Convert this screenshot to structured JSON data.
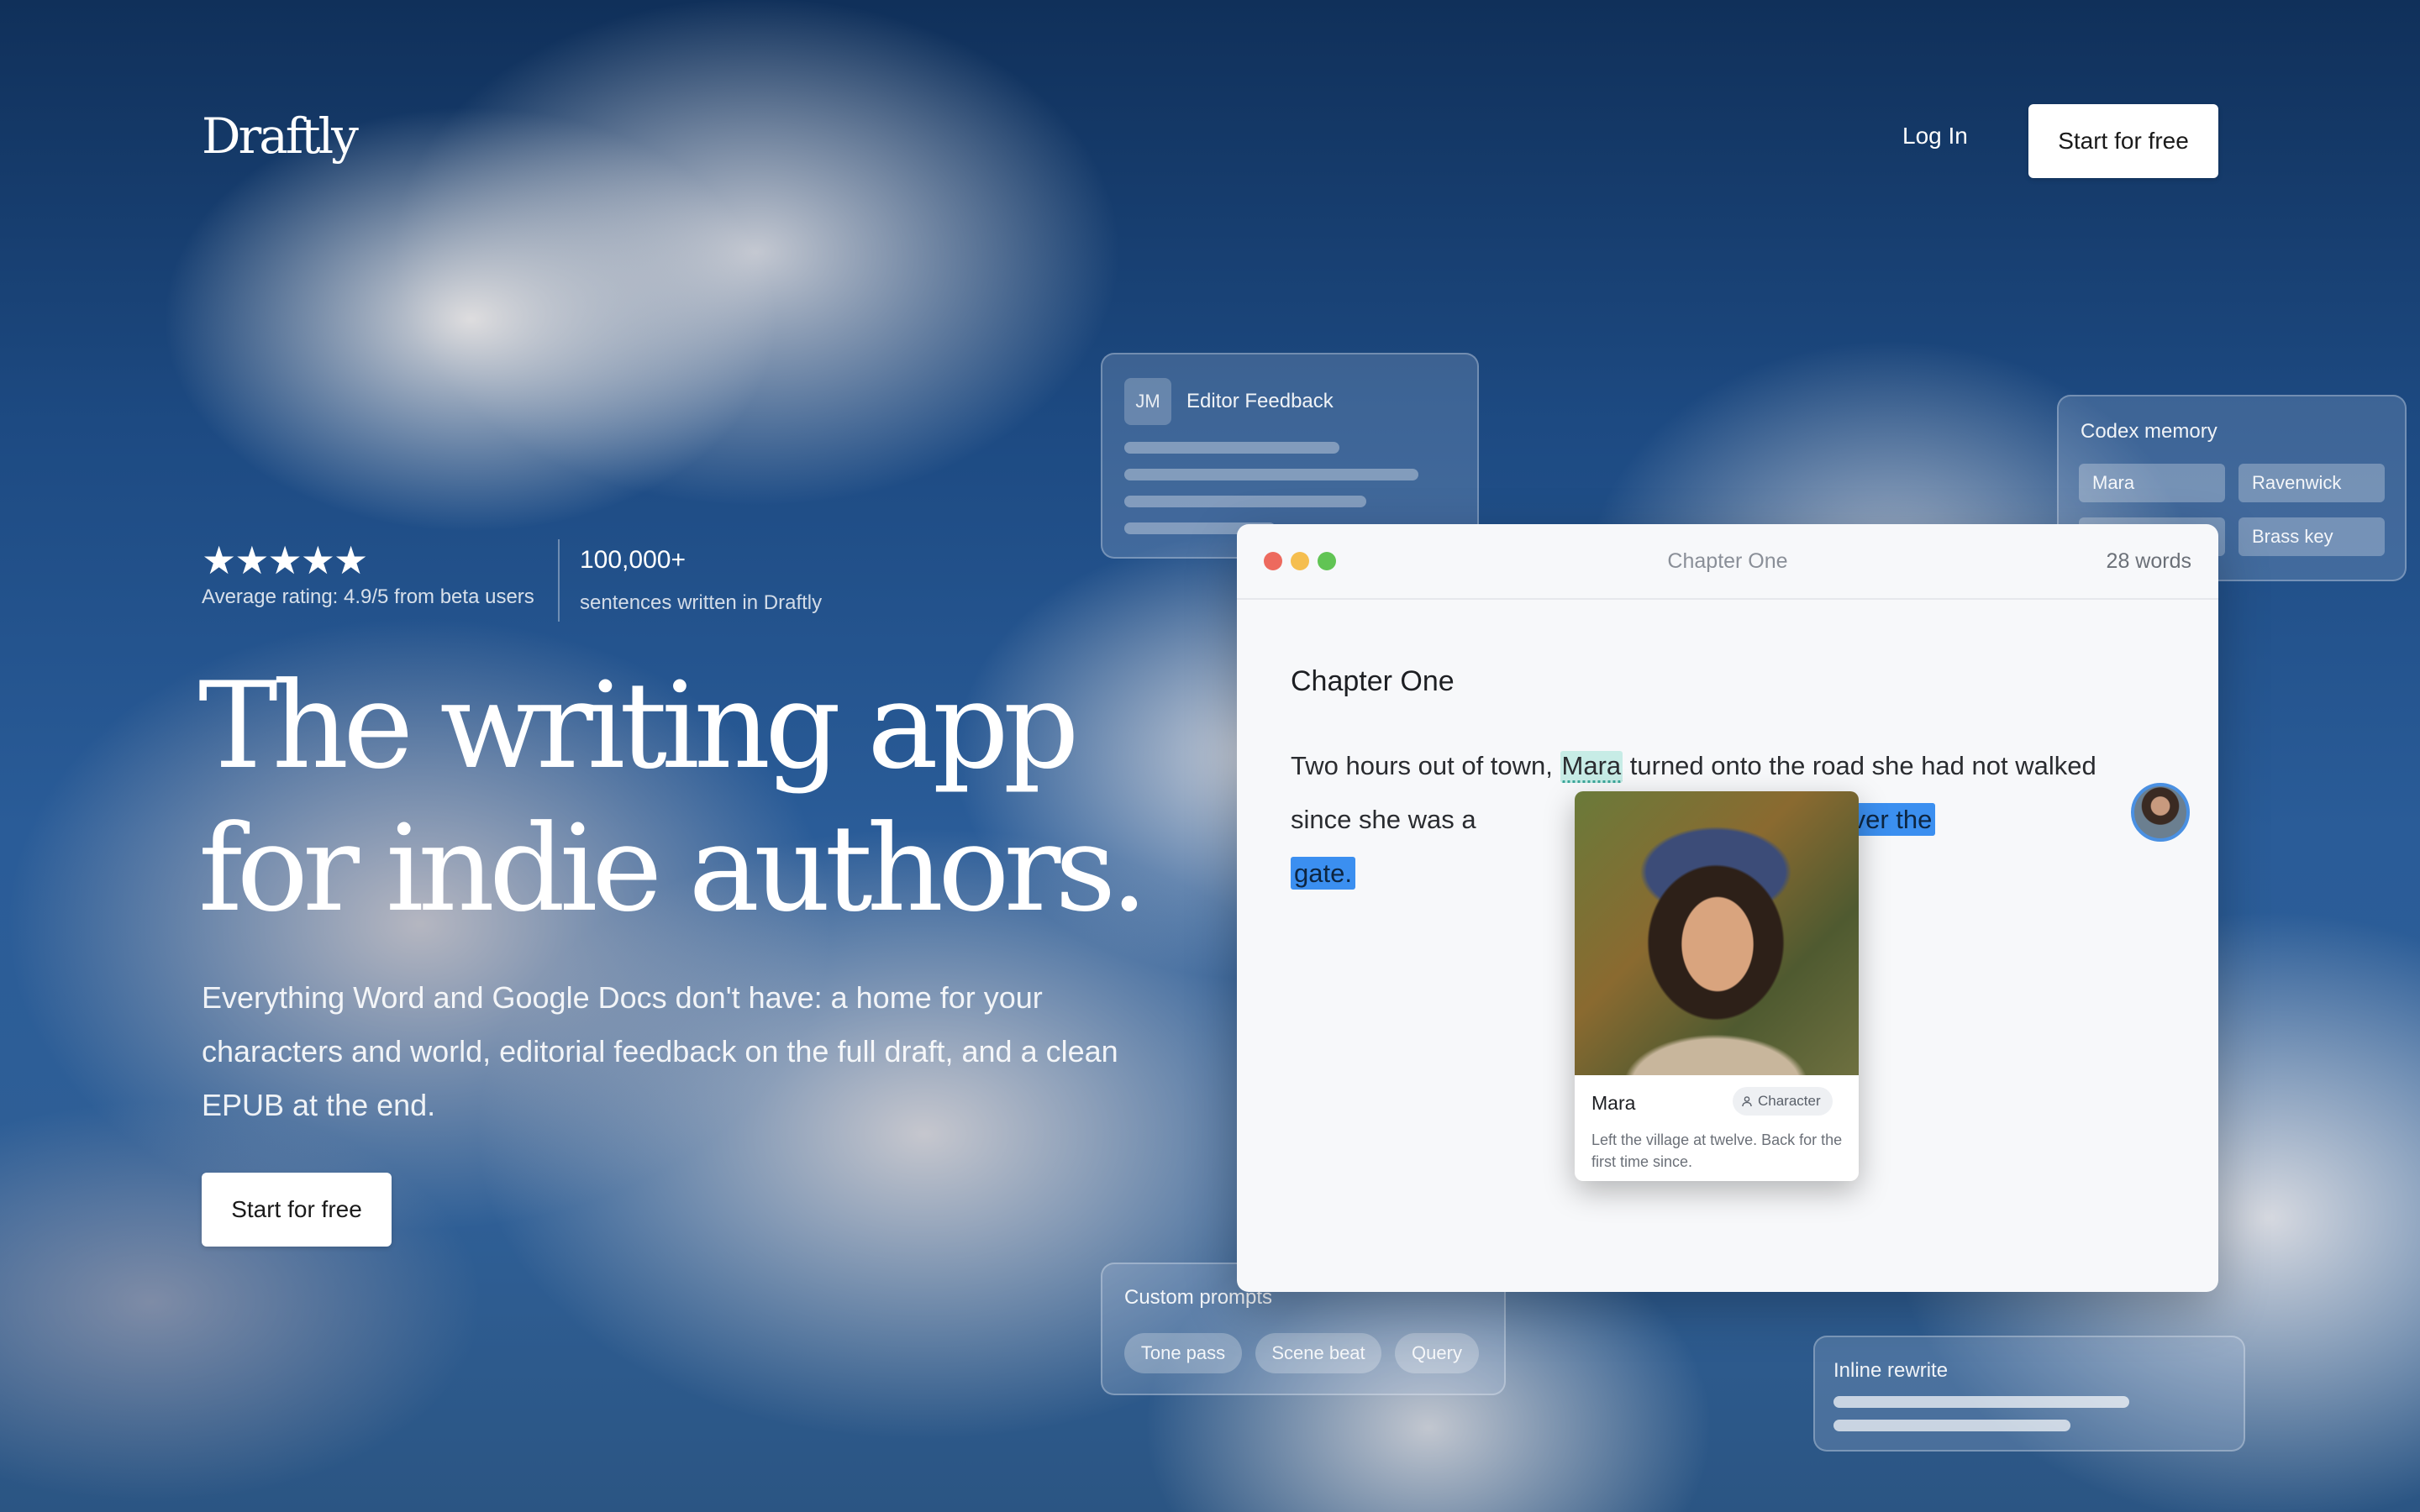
{
  "brand": {
    "logo": "Draftly"
  },
  "nav": {
    "login": "Log In",
    "cta": "Start for free"
  },
  "rating": {
    "stars": "★★★★★",
    "text": "Average rating: 4.9/5 from beta users",
    "stat_value": "100,000+",
    "stat_label": "sentences written in Draftly"
  },
  "hero": {
    "title_line1": "The writing app",
    "title_line2": "for indie authors.",
    "subtitle": "Everything Word and Google Docs don't have: a home for your characters and world, editorial feedback on the full draft, and a clean EPUB at the end.",
    "cta": "Start for free"
  },
  "feedback_card": {
    "avatar_initials": "JM",
    "title": "Editor Feedback"
  },
  "codex_card": {
    "title": "Codex memory",
    "chips": [
      "Mara",
      "Ravenwick",
      "",
      "Brass key"
    ]
  },
  "prompts_card": {
    "title": "Custom prompts",
    "pills": [
      "Tone pass",
      "Scene beat",
      "Query"
    ]
  },
  "rewrite_card": {
    "title": "Inline rewrite"
  },
  "editor": {
    "window_title": "Chapter One",
    "word_count": "28 words",
    "chapter_heading": "Chapter One",
    "para_1": "Two hours out of town, ",
    "para_name": "Mara",
    "para_2": " turned onto the road she had not walked since she was a ",
    "para_selected_1": "closed over the",
    "para_selected_2": "gate.",
    "colors": {
      "close": "#ed6a5e",
      "minimize": "#f5be4f",
      "maximize": "#61c454",
      "selection": "#3b8ff0"
    }
  },
  "character_card": {
    "name": "Mara",
    "badge": "Character",
    "description": "Left the village at twelve. Back for the first time since."
  }
}
